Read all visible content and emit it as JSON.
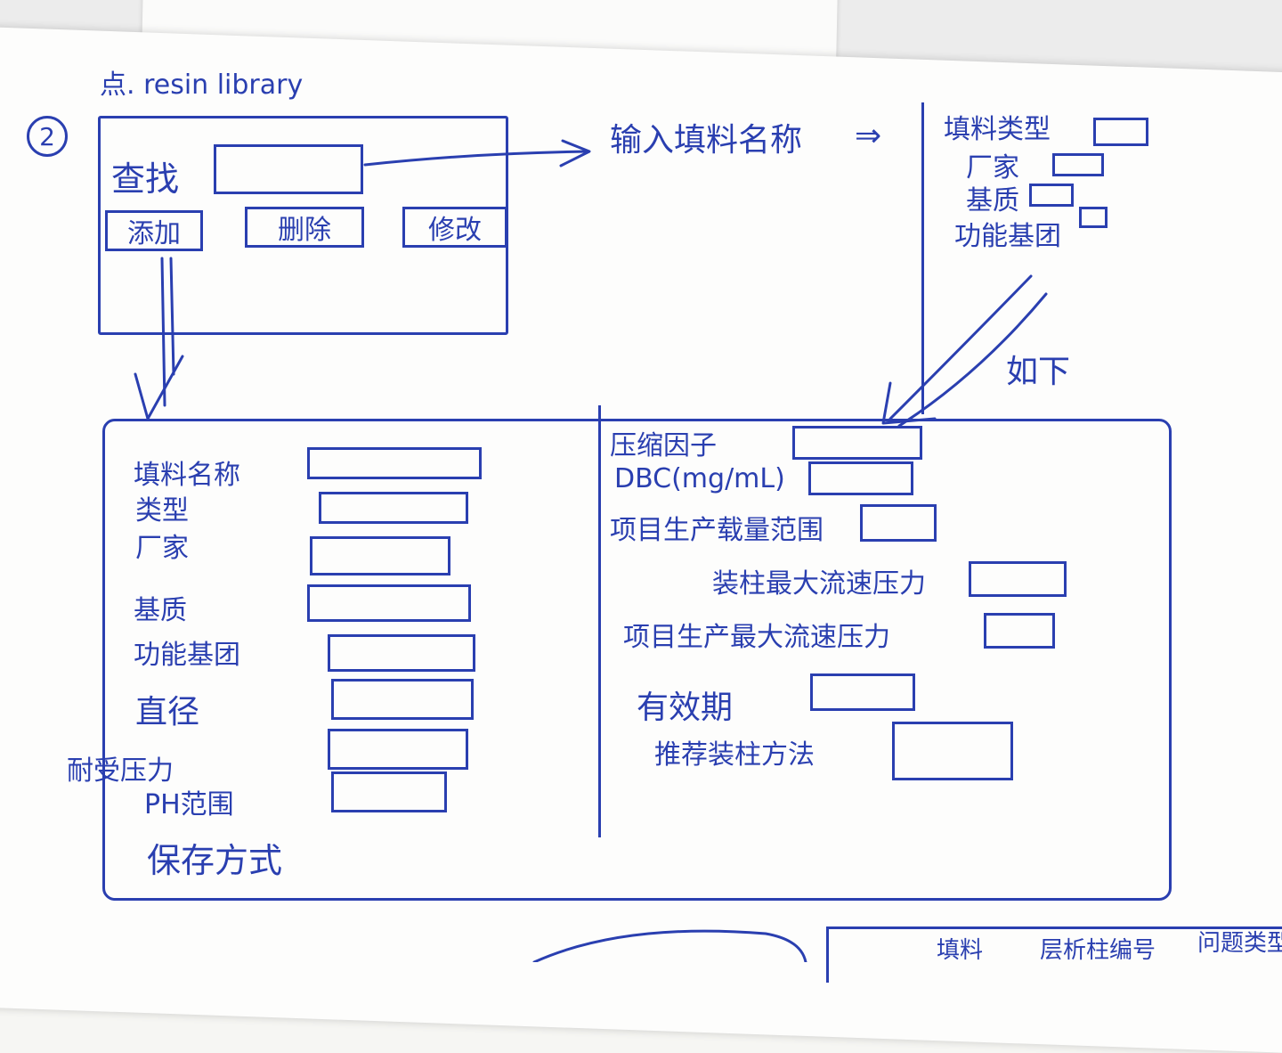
{
  "header": {
    "step": "2",
    "note": "点. resin library"
  },
  "search_panel": {
    "search_label": "查找",
    "add_button": "添加",
    "delete_button": "删除",
    "edit_button": "修改"
  },
  "flow": {
    "input_hint": "输入填料名称",
    "as_below": "如下"
  },
  "filter_panel": {
    "items": [
      "填料类型",
      "厂家",
      "基质",
      "功能基团"
    ]
  },
  "form_left": {
    "fields": [
      "填料名称",
      "类型",
      "厂家",
      "基质",
      "功能基团",
      "直径",
      "耐受压力",
      "PH范围",
      "保存方式"
    ]
  },
  "form_right": {
    "fields": [
      "压缩因子",
      "DBC(mg/mL)",
      "项目生产载量范围",
      "装柱最大流速压力",
      "项目生产最大流速压力",
      "有效期",
      "推荐装柱方法"
    ]
  },
  "bottom_row": {
    "items": [
      "填料",
      "层析柱编号",
      "问题类型"
    ]
  }
}
